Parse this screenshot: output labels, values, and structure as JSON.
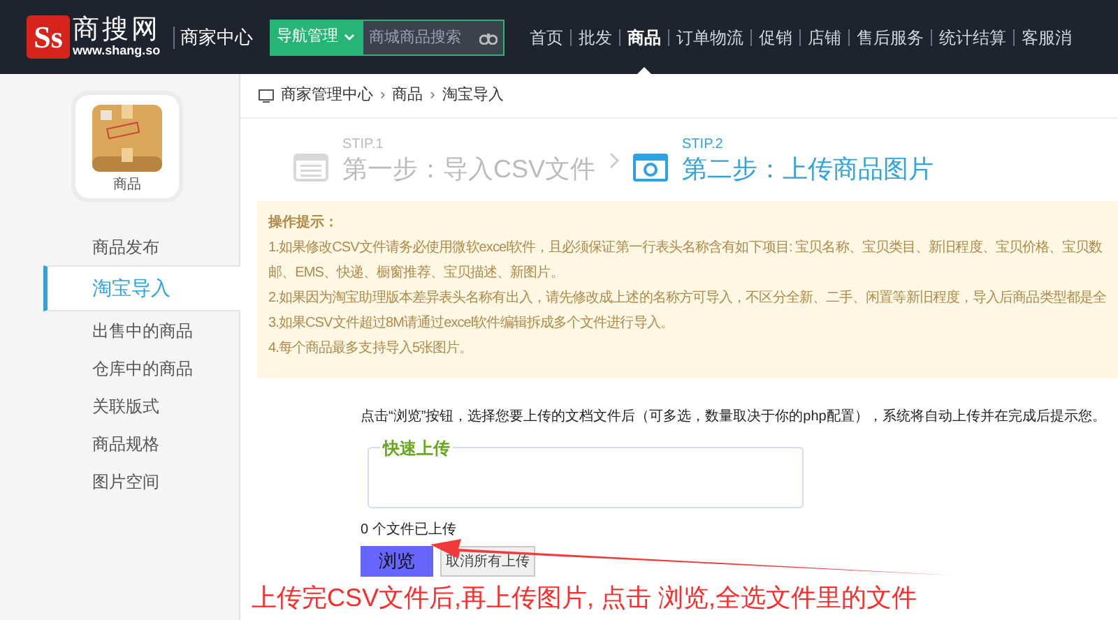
{
  "header": {
    "logo_mark": "Ss",
    "logo_name": "商搜网",
    "logo_url": "www.shang.so",
    "center_title": "商家中心",
    "nav_dropdown": "导航管理",
    "search": {
      "placeholder": "商城商品搜索"
    },
    "nav": [
      {
        "label": "首页",
        "selected": false
      },
      {
        "label": "批发",
        "selected": false
      },
      {
        "label": "商品",
        "selected": true
      },
      {
        "label": "订单物流",
        "selected": false
      },
      {
        "label": "促销",
        "selected": false
      },
      {
        "label": "店铺",
        "selected": false
      },
      {
        "label": "售后服务",
        "selected": false
      },
      {
        "label": "统计结算",
        "selected": false
      },
      {
        "label": "客服消",
        "selected": false
      }
    ]
  },
  "sidebar": {
    "module_label": "商品",
    "items": [
      {
        "label": "商品发布",
        "selected": false
      },
      {
        "label": "淘宝导入",
        "selected": true
      },
      {
        "label": "出售中的商品",
        "selected": false
      },
      {
        "label": "仓库中的商品",
        "selected": false
      },
      {
        "label": "关联版式",
        "selected": false
      },
      {
        "label": "商品规格",
        "selected": false
      },
      {
        "label": "图片空间",
        "selected": false
      }
    ]
  },
  "breadcrumb": [
    {
      "label": "商家管理中心"
    },
    {
      "separator": "›",
      "label": "商品"
    },
    {
      "separator": "›",
      "label": "淘宝导入"
    }
  ],
  "steps": [
    {
      "kind": "list",
      "tag": "STIP.1",
      "title": "第一步：导入CSV文件",
      "selected": false
    },
    {
      "kind": "camera",
      "tag": "STIP.2",
      "title": "第二步：上传商品图片",
      "selected": true
    }
  ],
  "notice": {
    "title": "操作提示：",
    "lines": [
      "1.如果修改CSV文件请务必使用微软excel软件，且必须保证第一行表头名称含有如下项目: 宝贝名称、宝贝类目、新旧程度、宝贝价格、宝贝数",
      "邮、EMS、快递、橱窗推荐、宝贝描述、新图片。",
      "2.如果因为淘宝助理版本差异表头名称有出入，请先修改成上述的名称方可导入，不区分全新、二手、闲置等新旧程度，导入后商品类型都是全",
      "3.如果CSV文件超过8M请通过excel软件编辑拆成多个文件进行导入。",
      "4.每个商品最多支持导入5张图片。"
    ]
  },
  "upload": {
    "instruction": "点击“浏览”按钮，选择您要上传的文档文件后（可多选，数量取决于你的php配置），系统将自动上传并在完成后提示您。",
    "box_legend": "快速上传",
    "status": "0 个文件已上传",
    "browse_button": "浏览",
    "cancel_button": "取消所有上传"
  },
  "annotation": "上传完CSV文件后,再上传图片, 点击 浏览,全选文件里的文件"
}
